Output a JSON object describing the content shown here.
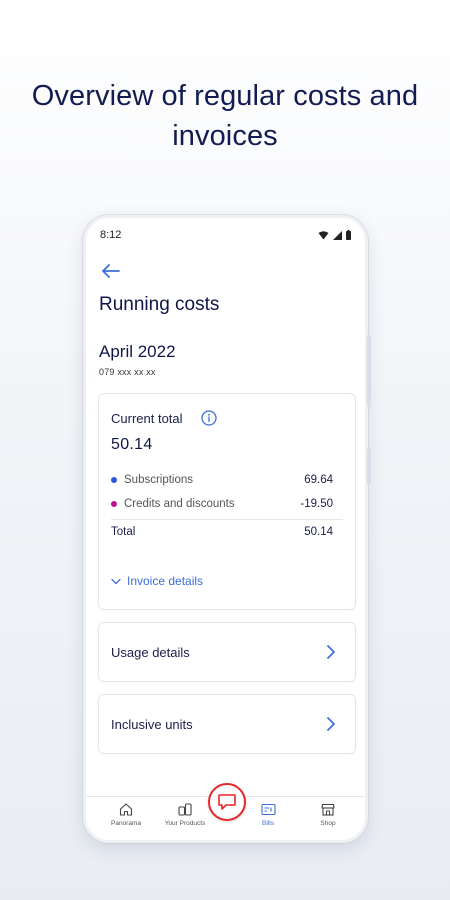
{
  "headline": "Overview of regular costs and invoices",
  "status": {
    "time": "8:12"
  },
  "page": {
    "title": "Running costs",
    "month": "April 2022",
    "phone_number": "079 xxx xx xx"
  },
  "summary": {
    "current_total_label": "Current total",
    "current_total_value": "50.14",
    "items": [
      {
        "label": "Subscriptions",
        "amount": "69.64",
        "dot_color": "#2a5bd7"
      },
      {
        "label": "Credits and discounts",
        "amount": "-19.50",
        "dot_color": "#b3168f"
      }
    ],
    "total_label": "Total",
    "total_value": "50.14",
    "invoice_details_label": "Invoice details"
  },
  "rows": {
    "usage_details": "Usage details",
    "inclusive_units": "Inclusive units"
  },
  "tabs": [
    {
      "label": "Panorama",
      "icon": "home-icon"
    },
    {
      "label": "Your Products",
      "icon": "products-icon"
    },
    {
      "label": "Bills",
      "icon": "bills-icon",
      "active": true
    },
    {
      "label": "Shop",
      "icon": "shop-icon"
    }
  ],
  "colors": {
    "accent": "#3d6fd9",
    "brand_red": "#e8272b",
    "text_dark": "#0f1748"
  }
}
